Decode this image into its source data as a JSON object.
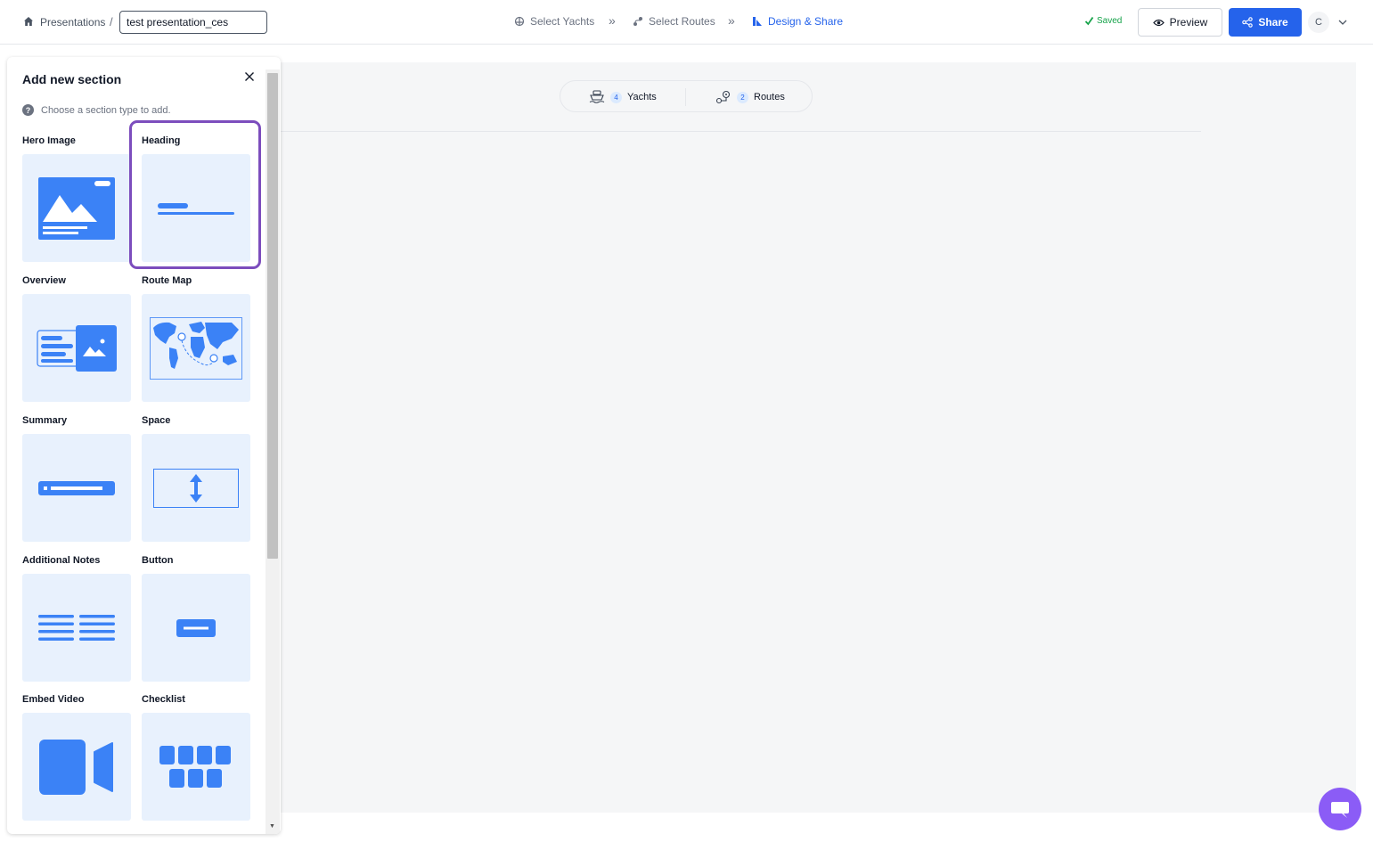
{
  "breadcrumb": {
    "home_label": "Presentations",
    "separator": "/"
  },
  "title_input": {
    "value": "test presentation_ces"
  },
  "steps": [
    {
      "label": "Select Yachts",
      "icon": "yacht-icon",
      "active": false
    },
    {
      "label": "Select Routes",
      "icon": "route-icon",
      "active": false
    },
    {
      "label": "Design & Share",
      "icon": "design-icon",
      "active": true
    }
  ],
  "status": {
    "saved_label": "Saved"
  },
  "actions": {
    "preview_label": "Preview",
    "share_label": "Share"
  },
  "user": {
    "avatar_initial": "C"
  },
  "summary_pill": {
    "yachts_count": "4",
    "yachts_label": "Yachts",
    "routes_count": "2",
    "routes_label": "Routes"
  },
  "panel": {
    "title": "Add new section",
    "hint": "Choose a section type to add.",
    "selected": "Heading",
    "sections": [
      {
        "label": "Hero Image",
        "icon": "hero-image-icon"
      },
      {
        "label": "Heading",
        "icon": "heading-icon"
      },
      {
        "label": "Overview",
        "icon": "overview-icon"
      },
      {
        "label": "Route Map",
        "icon": "route-map-icon"
      },
      {
        "label": "Summary",
        "icon": "summary-icon"
      },
      {
        "label": "Space",
        "icon": "space-icon"
      },
      {
        "label": "Additional Notes",
        "icon": "notes-icon"
      },
      {
        "label": "Button",
        "icon": "button-icon"
      },
      {
        "label": "Embed Video",
        "icon": "video-icon"
      },
      {
        "label": "Checklist",
        "icon": "checklist-icon"
      }
    ]
  },
  "colors": {
    "accent": "#2563eb",
    "tile_bg": "#e8f1fd",
    "selected_border": "#7c4dbd",
    "saved": "#16a34a",
    "chat": "#8b5cf6"
  }
}
